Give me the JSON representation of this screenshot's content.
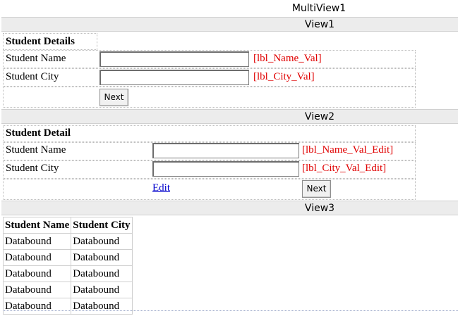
{
  "multiview": {
    "title": "MultiView1"
  },
  "view1": {
    "title": "View1",
    "heading": "Student Details",
    "name_label": "Student Name",
    "city_label": "Student City",
    "name_value": "[lbl_Name_Val]",
    "city_value": "[lbl_City_Val]",
    "next_button": "Next"
  },
  "view2": {
    "title": "View2",
    "heading": "Student Detail",
    "name_label": "Student Name",
    "city_label": "Student City",
    "name_value": "[lbl_Name_Val_Edit]",
    "city_value": "[lbl_City_Val_Edit]",
    "edit_link": "Edit",
    "next_button": "Next"
  },
  "view3": {
    "title": "View3",
    "columns": [
      "Student Name",
      "Student City"
    ],
    "rows": [
      [
        "Databound",
        "Databound"
      ],
      [
        "Databound",
        "Databound"
      ],
      [
        "Databound",
        "Databound"
      ],
      [
        "Databound",
        "Databound"
      ],
      [
        "Databound",
        "Databound"
      ]
    ]
  }
}
